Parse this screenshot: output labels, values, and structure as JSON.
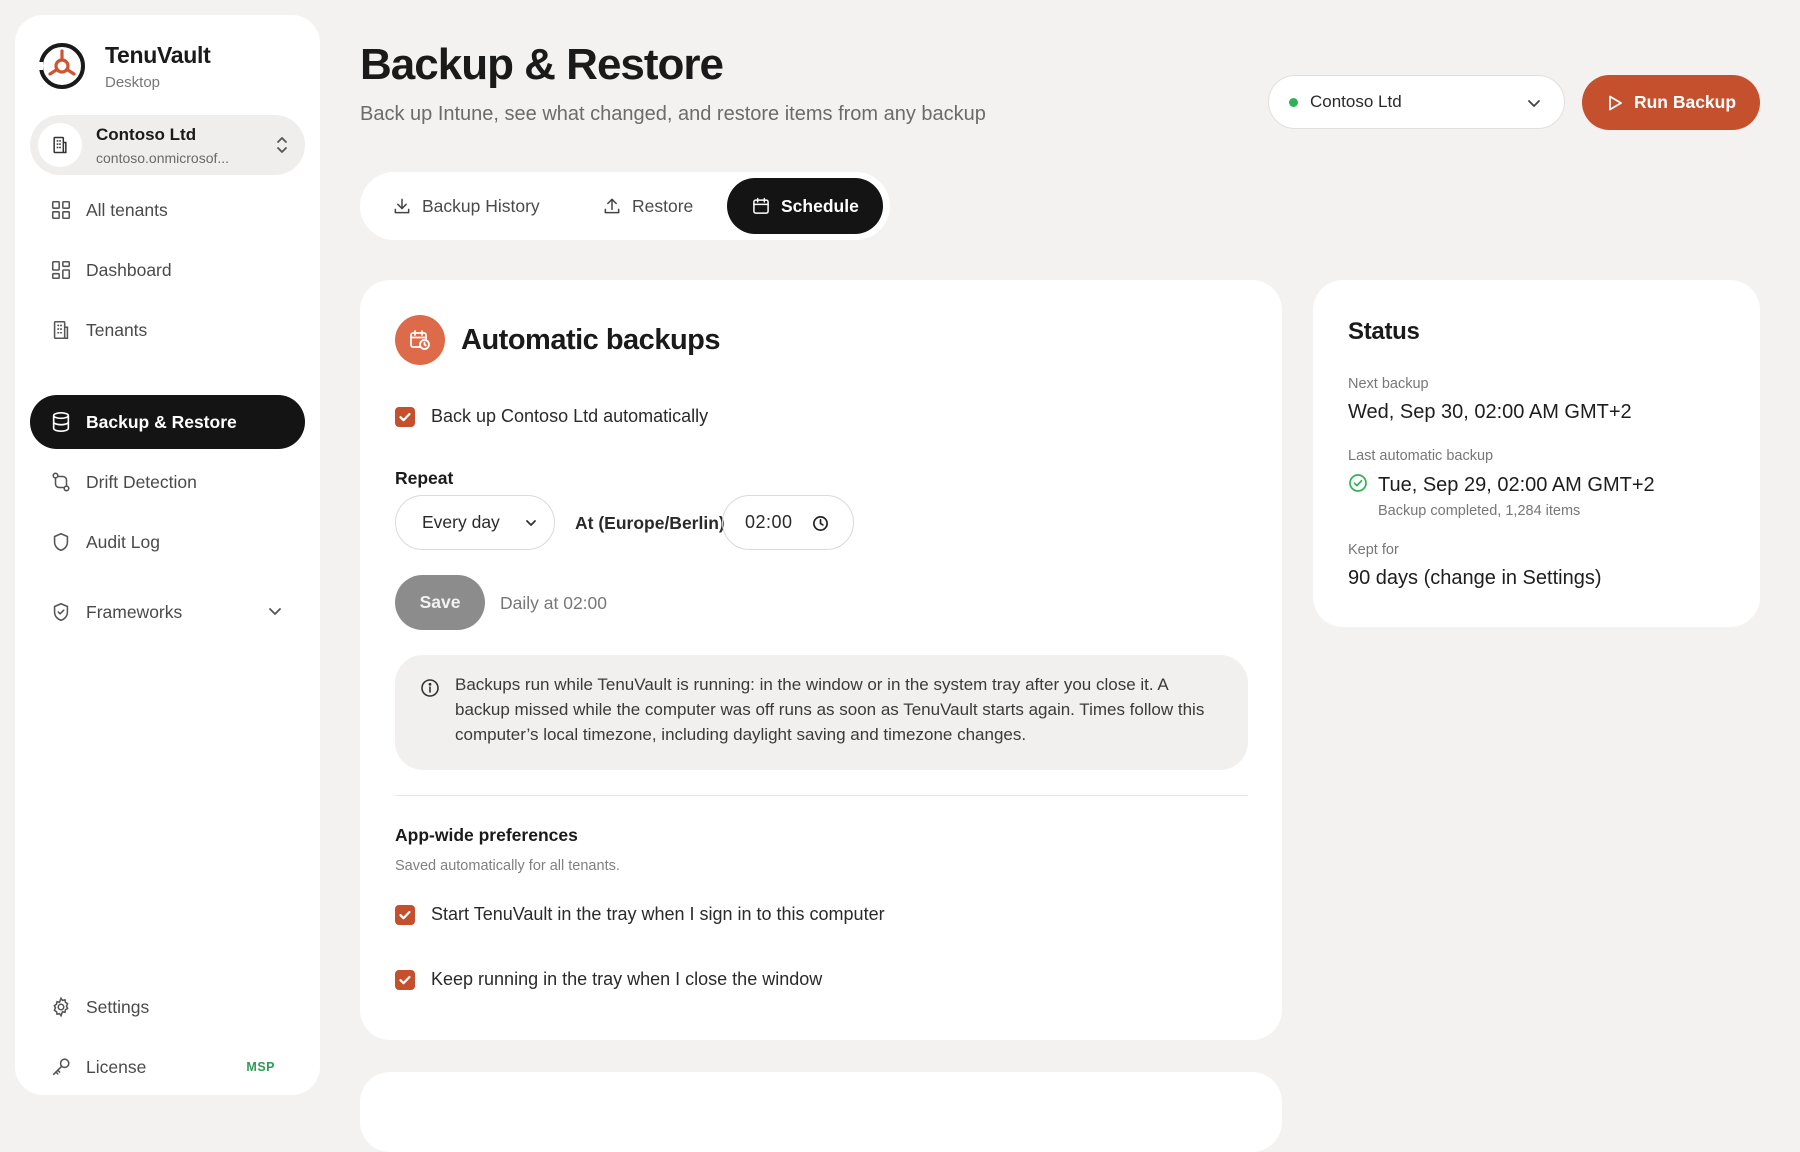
{
  "brand": {
    "name": "TenuVault",
    "subtitle": "Desktop"
  },
  "tenant_switcher": {
    "name": "Contoso Ltd",
    "domain": "contoso.onmicrosof..."
  },
  "nav": [
    {
      "label": "All tenants",
      "icon": "grid-icon"
    },
    {
      "label": "Dashboard",
      "icon": "dashboard-icon"
    },
    {
      "label": "Tenants",
      "icon": "building-icon"
    },
    {
      "label": "Backup & Restore",
      "icon": "database-icon",
      "active": true
    },
    {
      "label": "Drift Detection",
      "icon": "git-compare-icon"
    },
    {
      "label": "Audit Log",
      "icon": "shield-icon"
    },
    {
      "label": "Frameworks",
      "icon": "shield-check-icon"
    }
  ],
  "nav_bottom": {
    "settings": "Settings",
    "license": "License",
    "license_badge": "MSP"
  },
  "header": {
    "title": "Backup & Restore",
    "subtitle": "Back up Intune, see what changed, and restore items from any backup",
    "tenant_select": "Contoso Ltd",
    "run_backup": "Run Backup"
  },
  "tabs": [
    {
      "label": "Backup History",
      "icon": "download-icon"
    },
    {
      "label": "Restore",
      "icon": "upload-icon"
    },
    {
      "label": "Schedule",
      "icon": "calendar-icon",
      "active": true
    }
  ],
  "schedule": {
    "title": "Automatic backups",
    "auto_checkbox_label": "Back up Contoso Ltd automatically",
    "auto_checked": true,
    "repeat_label": "Repeat",
    "repeat_value": "Every day",
    "at_label": "At (Europe/Berlin)",
    "time_value": "02:00",
    "save_label": "Save",
    "save_hint": "Daily at 02:00",
    "info": "Backups run while TenuVault is running: in the window or in the system tray after you close it. A backup missed while the computer was off runs as soon as TenuVault starts again. Times follow this computer’s local timezone, including daylight saving and timezone changes.",
    "prefs_title": "App-wide preferences",
    "prefs_subtitle": "Saved automatically for all tenants.",
    "pref_tray_start": "Start TenuVault in the tray when I sign in to this computer",
    "pref_tray_keep": "Keep running in the tray when I close the window"
  },
  "status": {
    "title": "Status",
    "next_label": "Next backup",
    "next_value": "Wed, Sep 30, 02:00 AM GMT+2",
    "last_label": "Last automatic backup",
    "last_value": "Tue, Sep 29, 02:00 AM GMT+2",
    "last_detail": "Backup completed, 1,284 items",
    "kept_label": "Kept for",
    "kept_value": "90 days (change in Settings)"
  },
  "colors": {
    "accent": "#c4502d",
    "accent_icon_bg": "#dd6b4a",
    "active_nav": "#141414",
    "success": "#2fb256"
  }
}
